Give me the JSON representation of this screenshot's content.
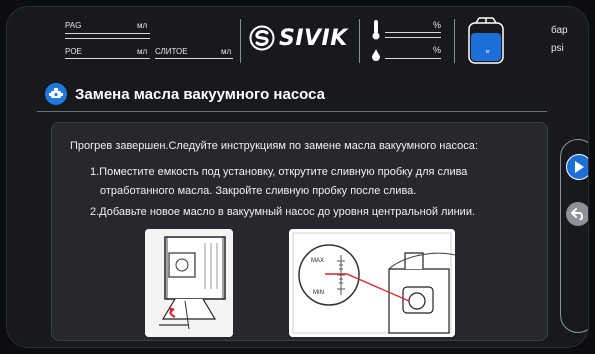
{
  "status": {
    "pag_label": "PAG",
    "poe_label": "POE",
    "fill_label": "СЛИТОЕ",
    "unit_ml": "мл",
    "brand": "SIVIK",
    "percent": "%",
    "unit_bar": "бар",
    "unit_psi": "psi",
    "tank_label": "кг"
  },
  "header": {
    "title": "Замена масла вакуумного насоса",
    "icon": "pump-icon"
  },
  "content": {
    "line1": "Прогрев завершен.Следуйте инструкциям по замене масла вакуумного насоса:",
    "line2": "1.Поместите емкость  под установку, открутите сливную пробку для слива",
    "line3": "отработанного масла. Закройте сливную пробку после слива.",
    "line4": "2.Добавьте новое масло в вакуумный насос до уровня центральной линии.",
    "gauge_max": "MAX",
    "gauge_min": "MIN"
  },
  "side": {
    "next_icon": "play-icon",
    "back_icon": "back-arrow-icon"
  },
  "colors": {
    "accent": "#1c6fd6",
    "background": "#17191d",
    "panel": "#26282d"
  }
}
